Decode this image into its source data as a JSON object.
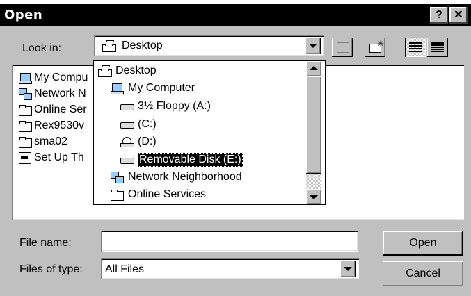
{
  "window": {
    "title": "Open",
    "help_button": "?",
    "close_button": "✕"
  },
  "look_in": {
    "label": "Look in:",
    "value": "Desktop"
  },
  "toolbar": {
    "up_folder": "up-one-level-icon",
    "new_folder": "create-new-folder-icon",
    "list_view": "list-view-icon",
    "details_view": "details-view-icon"
  },
  "files": [
    {
      "name": "My Compu",
      "icon": "computer-icon"
    },
    {
      "name": "Network N",
      "icon": "network-icon"
    },
    {
      "name": "Online Ser",
      "icon": "folder-icon"
    },
    {
      "name": "Rex9530v",
      "icon": "folder-icon"
    },
    {
      "name": "sma02",
      "icon": "folder-icon"
    },
    {
      "name": "Set Up Th",
      "icon": "setup-icon"
    }
  ],
  "dropdown_items": [
    {
      "label": "Desktop",
      "icon": "desktop-icon"
    },
    {
      "label": "My Computer",
      "icon": "computer-icon"
    },
    {
      "label": "3½ Floppy (A:)",
      "icon": "floppy-drive-icon"
    },
    {
      "label": "(C:)",
      "icon": "hard-drive-icon"
    },
    {
      "label": "(D:)",
      "icon": "cd-drive-icon"
    },
    {
      "label": "Removable Disk (E:)",
      "icon": "removable-disk-icon"
    },
    {
      "label": "Network Neighborhood",
      "icon": "network-icon"
    },
    {
      "label": "Online Services",
      "icon": "folder-icon"
    }
  ],
  "file_name": {
    "label": "File name:",
    "value": ""
  },
  "file_type": {
    "label": "Files of type:",
    "value": "All Files"
  },
  "buttons": {
    "open": "Open",
    "cancel": "Cancel"
  }
}
